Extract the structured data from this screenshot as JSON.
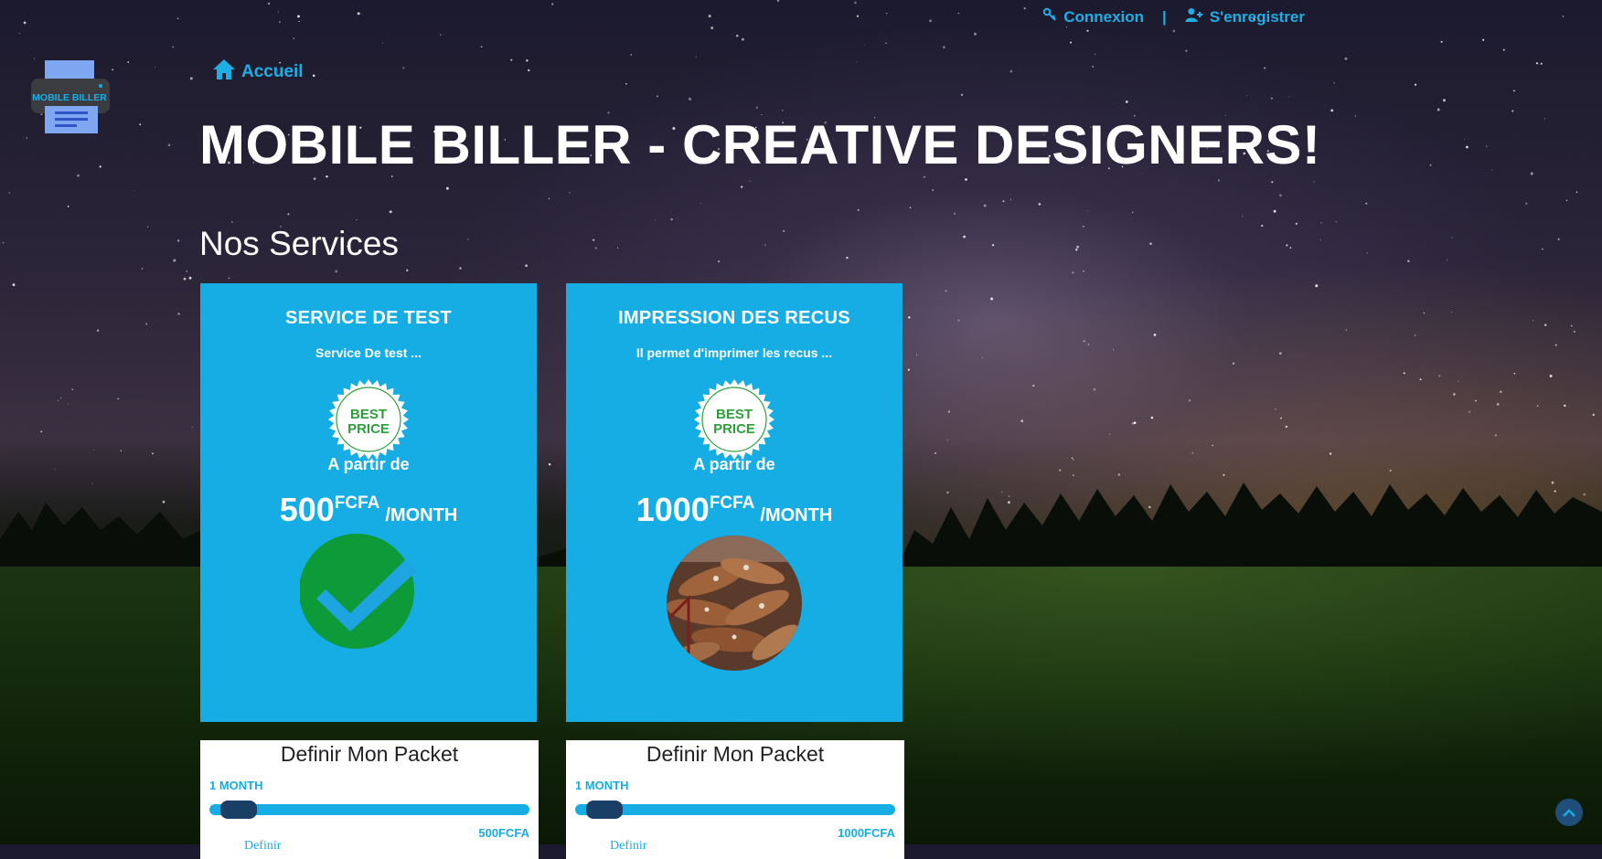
{
  "nav": {
    "login_label": "Connexion",
    "separator": "|",
    "register_label": "S'enregistrer"
  },
  "logo": {
    "text": "MOBILE BILLER"
  },
  "breadcrumb": {
    "home_label": "Accueil"
  },
  "page_title": "MOBILE BILLER - CREATIVE DESIGNERS!",
  "section_title": "Nos Services",
  "badge": {
    "line1": "BEST",
    "line2": "PRICE"
  },
  "services": [
    {
      "name": "SERVICE DE TEST",
      "description": "Service De test ...",
      "from_label": "A partir de",
      "price": "500",
      "currency": "FCFA",
      "period": "/MONTH",
      "image": "green-check-icon",
      "packet": {
        "title": "Definir Mon Packet",
        "duration_label": "1 MONTH",
        "slider_fraction": 0.0,
        "price_label": "500FCFA",
        "cut_text": "Definir"
      }
    },
    {
      "name": "IMPRESSION DES RECUS",
      "description": "Il permet d'imprimer les recus ...",
      "from_label": "A partir de",
      "price": "1000",
      "currency": "FCFA",
      "period": "/MONTH",
      "image": "cassava-photo",
      "packet": {
        "title": "Definir Mon Packet",
        "duration_label": "1 MONTH",
        "slider_fraction": 0.0,
        "price_label": "1000FCFA",
        "cut_text": "Definir"
      }
    }
  ],
  "colors": {
    "accent": "#16ade4",
    "slider_thumb": "#1a3f66",
    "badge_green": "#2e9e3c",
    "check_green": "#0d9b3a"
  }
}
